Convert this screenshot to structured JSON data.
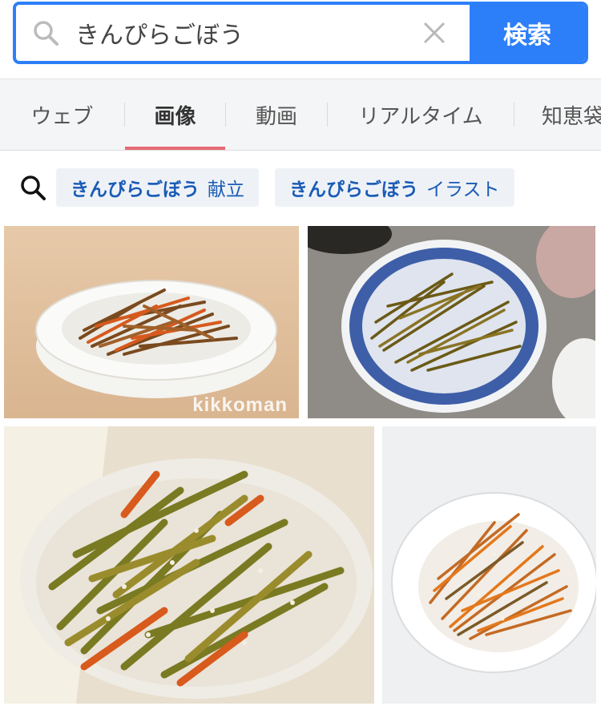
{
  "search": {
    "query": "きんぴらごぼう",
    "button_label": "検索"
  },
  "tabs": [
    {
      "label": "ウェブ",
      "active": false
    },
    {
      "label": "画像",
      "active": true
    },
    {
      "label": "動画",
      "active": false
    },
    {
      "label": "リアルタイム",
      "active": false
    },
    {
      "label": "知恵袋",
      "active": false
    }
  ],
  "related": [
    {
      "strong": "きんぴらごぼう",
      "rest": "献立"
    },
    {
      "strong": "きんぴらごぼう",
      "rest": "イラスト"
    }
  ],
  "images": [
    {
      "watermark": "kikkoman"
    },
    {
      "watermark": ""
    },
    {
      "watermark": ""
    },
    {
      "watermark": ""
    }
  ],
  "colors": {
    "accent": "#2d7ff9",
    "tab_indicator": "#e86a74",
    "chip_text": "#1a5bb5"
  }
}
